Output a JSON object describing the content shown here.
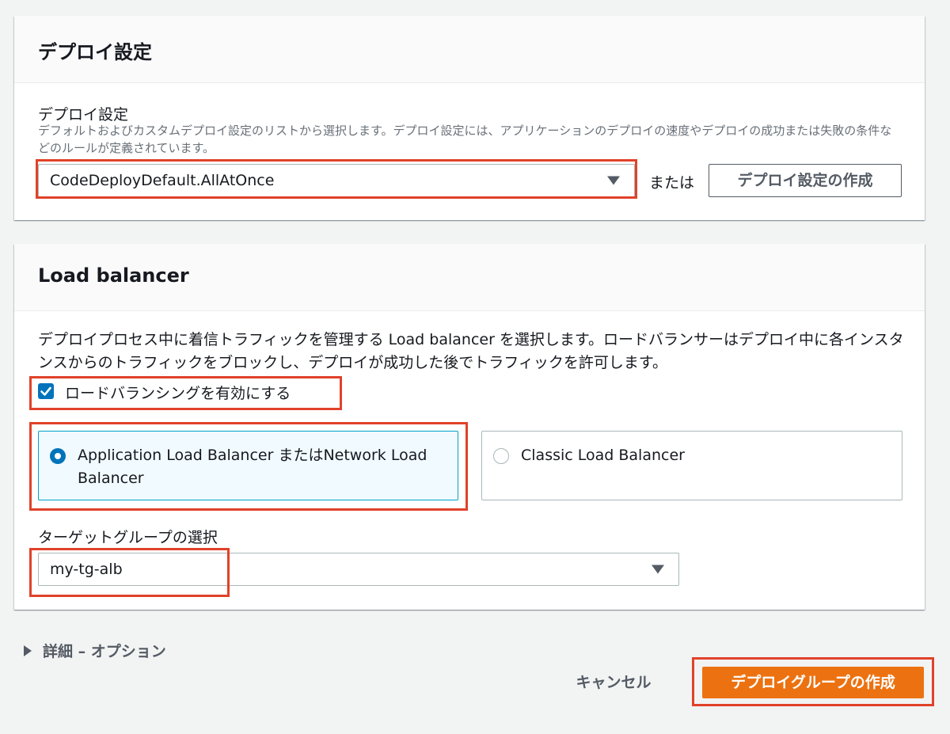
{
  "deploy_panel": {
    "title": "デプロイ設定",
    "field_label": "デプロイ設定",
    "description": "デフォルトおよびカスタムデプロイ設定のリストから選択します。デプロイ設定には、アプリケーションのデプロイの速度やデプロイの成功または失敗の条件などのルールが定義されています。",
    "selected_config": "CodeDeployDefault.AllAtOnce",
    "or_text": "または",
    "create_button": "デプロイ設定の作成"
  },
  "lb_panel": {
    "title": "Load balancer",
    "description": "デプロイプロセス中に着信トラフィックを管理する Load balancer を選択します。ロードバランサーはデプロイ中に各インスタンスからのトラフィックをブロックし、デプロイが成功した後でトラフィックを許可します。",
    "enable_checkbox_label": "ロードバランシングを有効にする",
    "enable_checked": true,
    "options": [
      {
        "label": "Application Load Balancer またはNetwork Load Balancer",
        "selected": true
      },
      {
        "label": "Classic Load Balancer",
        "selected": false
      }
    ],
    "target_group_label": "ターゲットグループの選択",
    "target_group_value": "my-tg-alb"
  },
  "advanced": {
    "label": "詳細 – オプション"
  },
  "footer": {
    "cancel": "キャンセル",
    "create": "デプロイグループの作成"
  },
  "colors": {
    "primary": "#ec7211",
    "accent_blue": "#0073bb",
    "highlight_red": "#e0422a"
  }
}
